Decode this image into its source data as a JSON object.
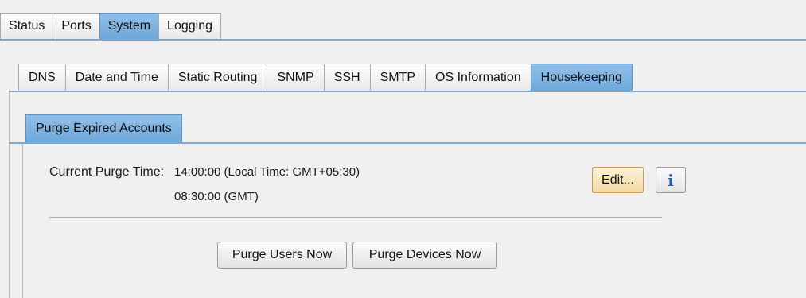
{
  "top_tabs": {
    "items": [
      {
        "label": "Status"
      },
      {
        "label": "Ports"
      },
      {
        "label": "System"
      },
      {
        "label": "Logging"
      }
    ],
    "active": "System"
  },
  "sub_tabs": {
    "items": [
      {
        "label": "DNS"
      },
      {
        "label": "Date and Time"
      },
      {
        "label": "Static Routing"
      },
      {
        "label": "SNMP"
      },
      {
        "label": "SSH"
      },
      {
        "label": "SMTP"
      },
      {
        "label": "OS Information"
      },
      {
        "label": "Housekeeping"
      }
    ],
    "active": "Housekeeping"
  },
  "inner_tabs": {
    "items": [
      {
        "label": "Purge Expired Accounts"
      }
    ],
    "active": "Purge Expired Accounts"
  },
  "purge": {
    "label": "Current Purge Time:",
    "local_time": "14:00:00 (Local Time:  GMT+05:30)",
    "gmt_time": "08:30:00 (GMT)"
  },
  "buttons": {
    "edit": "Edit...",
    "info": "i",
    "purge_users": "Purge Users Now",
    "purge_devices": "Purge Devices Now"
  },
  "colors": {
    "active_tab": "#7fb3e2",
    "edit_button": "#f3d9a2",
    "info_icon": "#2b5fa8"
  }
}
